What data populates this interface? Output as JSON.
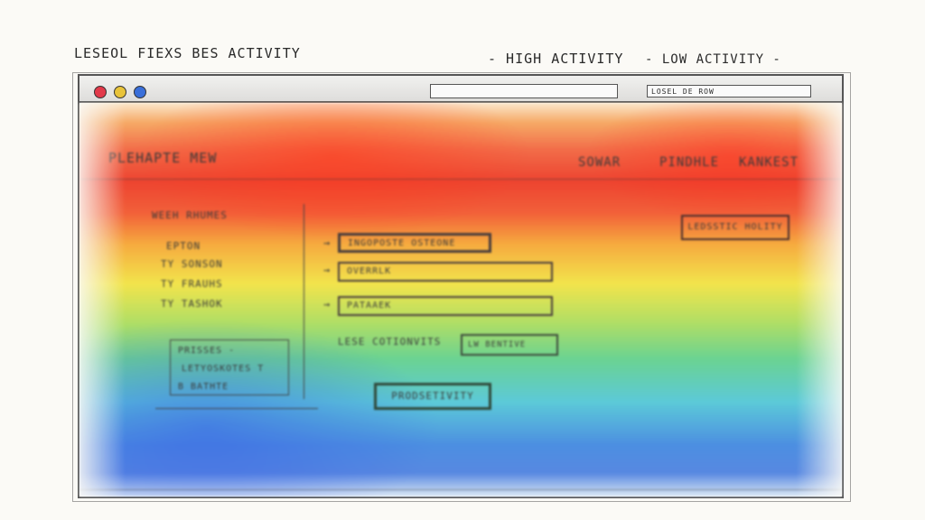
{
  "legend": {
    "title": "LESEOL FIEXS BES ACTIVITY",
    "high": "- HIGH ACTIVITY",
    "low": "- LOW ACTIVITY -"
  },
  "browser": {
    "search_text": "LOSEL DE ROW"
  },
  "header": {
    "brand": "PLEHAPTE MEW",
    "nav": [
      "SOWAR",
      "PINDHLE",
      "KANKEST"
    ]
  },
  "sidebar": {
    "heading": "WEEH RHUMES",
    "links": [
      "EPTON",
      "TY SONSON",
      "TY FRAUHS",
      "TY TASHOK"
    ],
    "box_lines": [
      "PRISSES -",
      "LETYOSKOTES T",
      "B BATHTE"
    ]
  },
  "main": {
    "buttons": [
      "INGOPOSTE OSTEONE",
      "OVERRLK",
      "PATAAEK"
    ],
    "less_label": "LESE COTIONVITS",
    "less_button": "LW BENTIVE",
    "productivity_button": "PRODSETIVITY",
    "right_button": "LEDSSTIC HOLITY"
  },
  "colors": {
    "high": "#ec3520",
    "mid": "#f2e33e",
    "low": "#3e86e0"
  }
}
